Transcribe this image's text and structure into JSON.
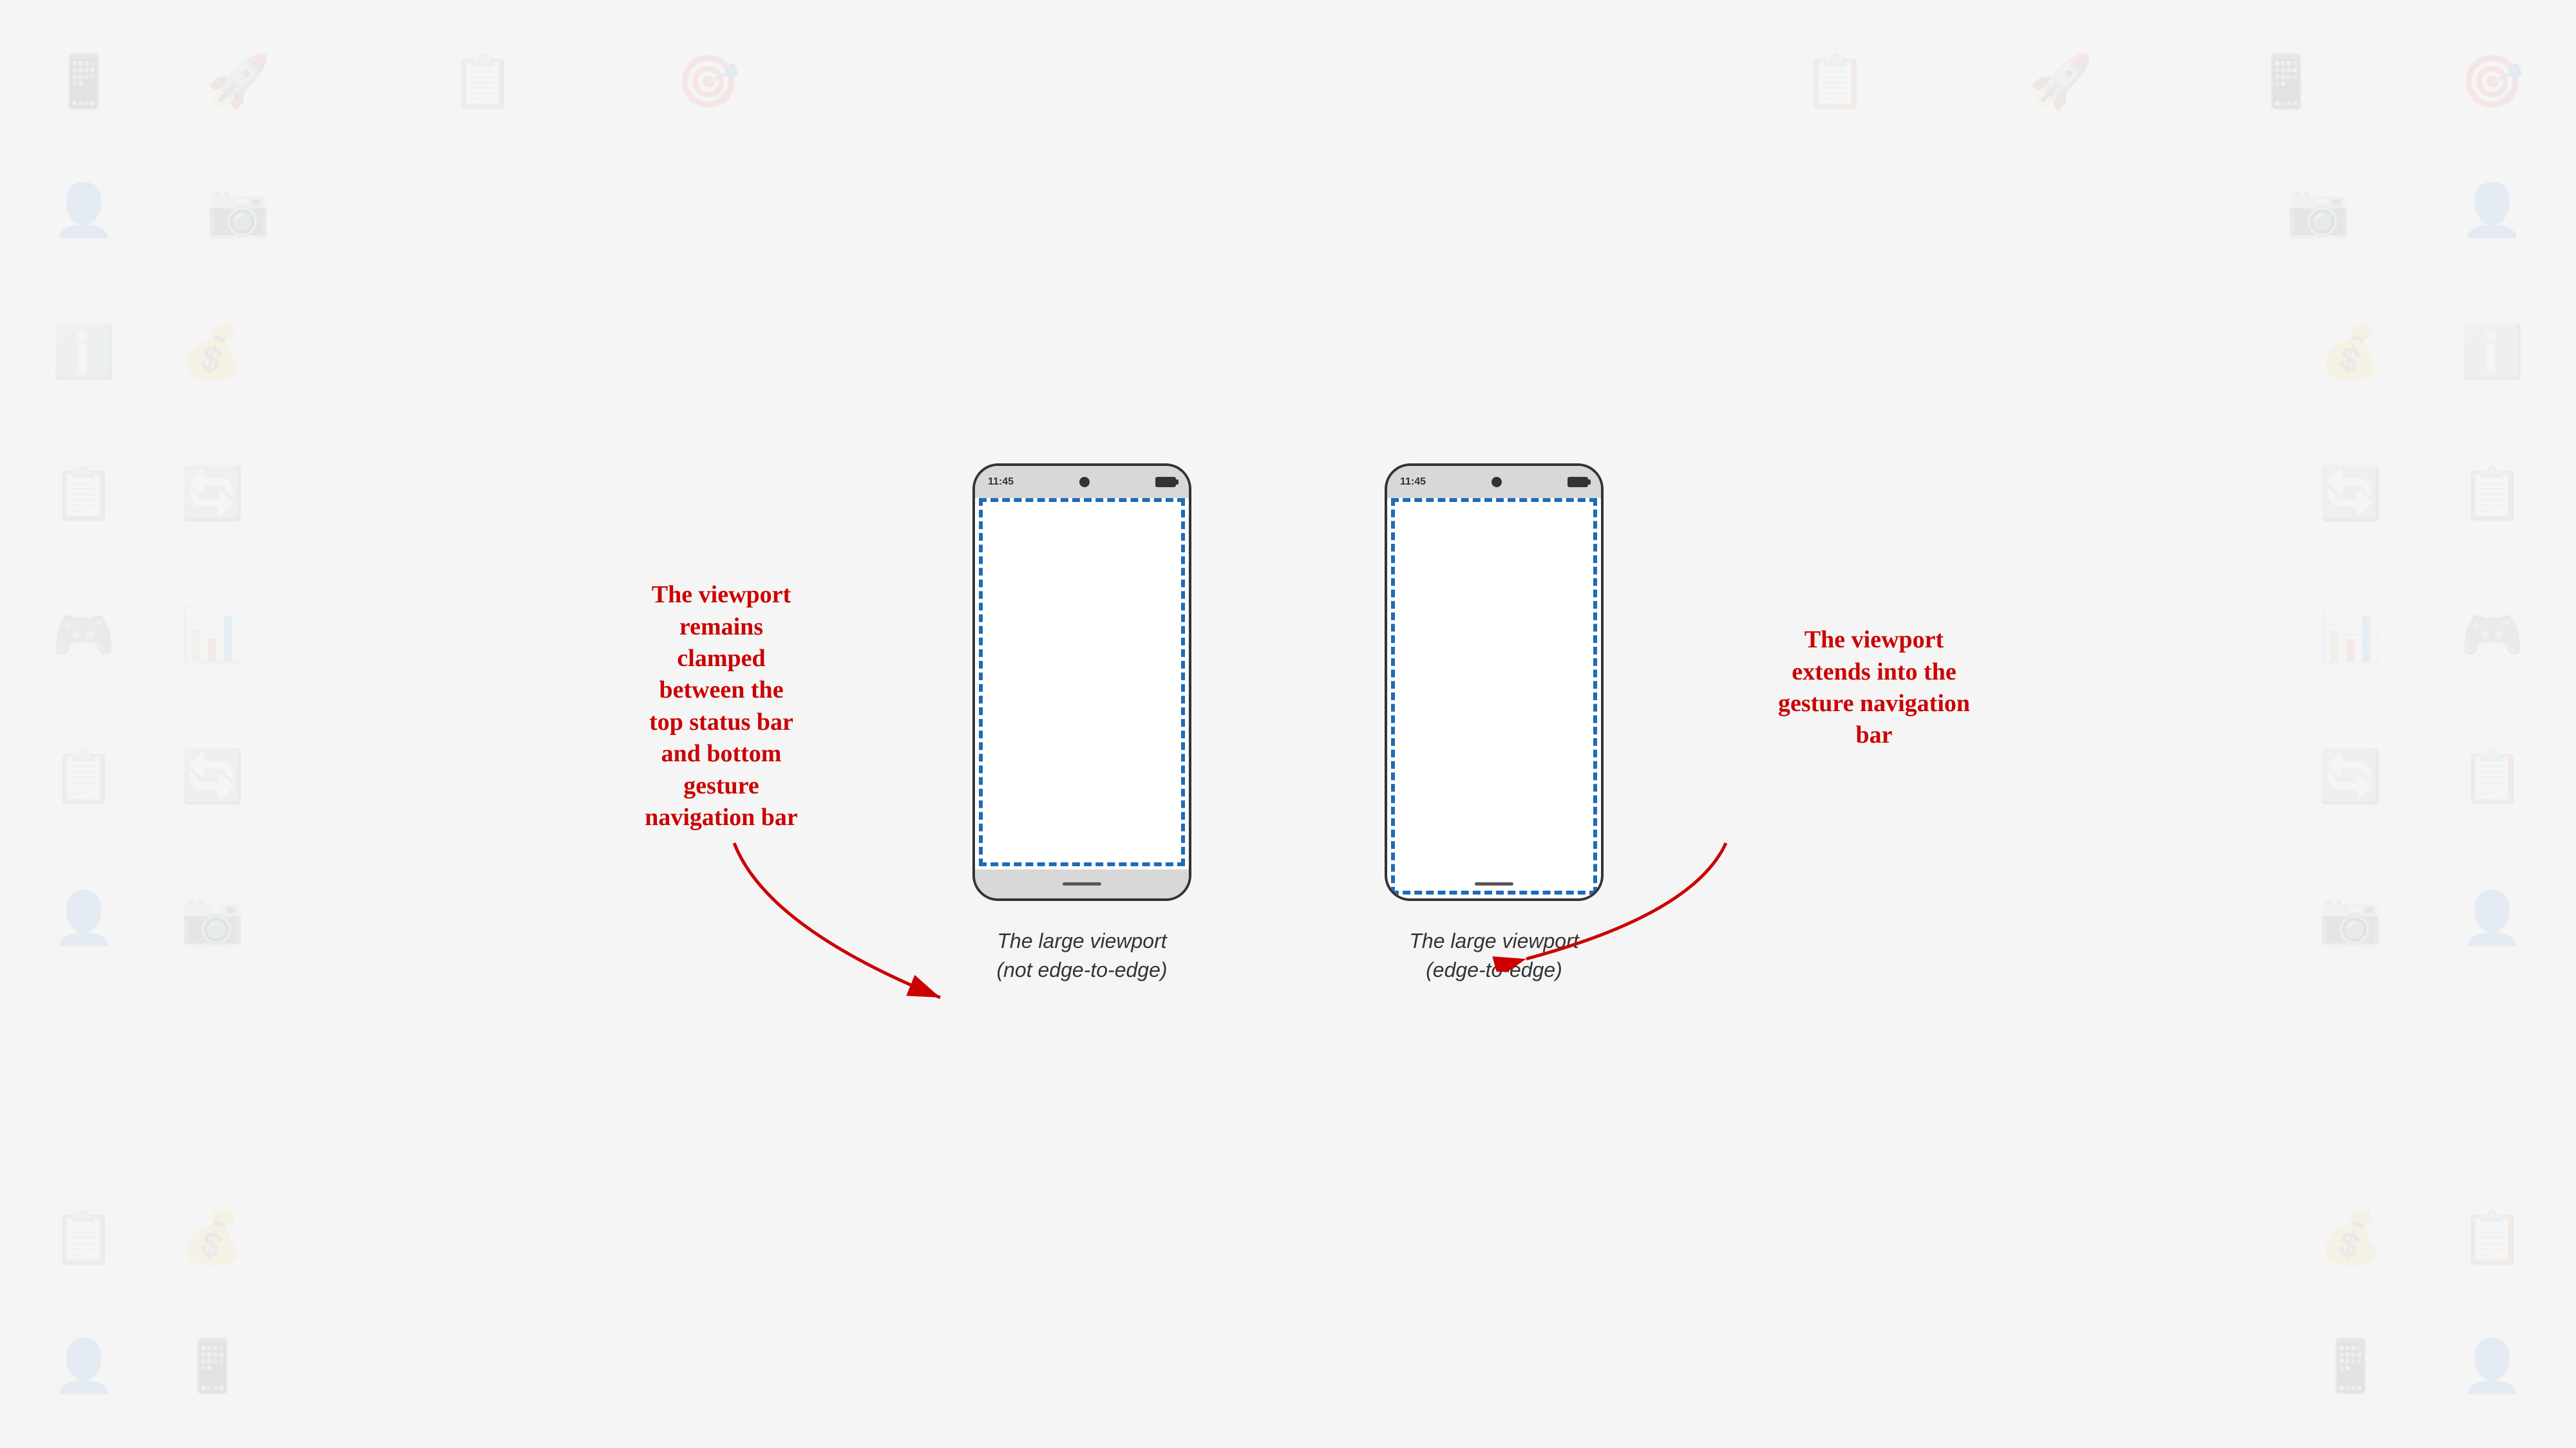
{
  "background": {
    "icon_opacity": 0.07
  },
  "phones": [
    {
      "id": "not-edge-to-edge",
      "status_bar": {
        "time": "11:45"
      },
      "caption_line1": "The large viewport",
      "caption_line2": "(not edge-to-edge)"
    },
    {
      "id": "edge-to-edge",
      "status_bar": {
        "time": "11:45"
      },
      "caption_line1": "The large viewport",
      "caption_line2": "(edge-to-edge)"
    }
  ],
  "annotations": {
    "left": {
      "text": "The viewport\nremains\nclamped\nbetween the\ntop status bar\nand bottom\ngesture\nnavigation bar"
    },
    "right": {
      "text": "The viewport\nextends into the\ngesture navigation\nbar"
    }
  }
}
